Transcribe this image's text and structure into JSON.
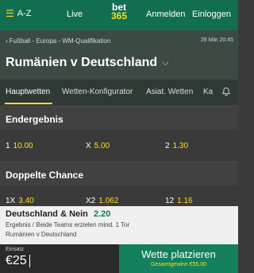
{
  "topbar": {
    "az_label": "A-Z",
    "live_label": "Live",
    "logo_top": "bet",
    "logo_bottom": "365",
    "login_label": "Anmelden",
    "signin_label": "Einloggen"
  },
  "header": {
    "breadcrumb": "Fußball - Europa - WM-Qualifikation",
    "datetime": "28 Mär 20:45",
    "match_title": "Rumänien v Deutschland"
  },
  "tabs": [
    {
      "label": "Hauptwetten",
      "active": true
    },
    {
      "label": "Wetten-Konfigurator",
      "active": false
    },
    {
      "label": "Asiat. Wetten",
      "active": false
    },
    {
      "label": "Ka",
      "active": false
    }
  ],
  "sections": {
    "endergebnis": {
      "title": "Endergebnis",
      "odds": [
        {
          "label": "1",
          "value": "10.00"
        },
        {
          "label": "X",
          "value": "5.00"
        },
        {
          "label": "2",
          "value": "1.30"
        }
      ]
    },
    "doppelte_chance": {
      "title": "Doppelte Chance",
      "odds": [
        {
          "label": "1X",
          "value": "3.40"
        },
        {
          "label": "X2",
          "value": "1.062"
        },
        {
          "label": "12",
          "value": "1.16"
        }
      ]
    }
  },
  "betslip": {
    "selection": "Deutschland & Nein",
    "price": "2.20",
    "market": "Ergebnis / Beide Teams erzielen mind. 1 Tor",
    "event": "Rumänien v Deutschland"
  },
  "bottom": {
    "stake_label": "Einsatz",
    "stake_amount": "€25",
    "place_label": "Wette platzieren",
    "total_win": "Gesamtgewinn €55,00"
  },
  "colors": {
    "brand_green": "#126e51",
    "accent_yellow": "#ffdf1b",
    "place_green": "#14805e"
  },
  "icons": [
    "menu-icon",
    "chevron-left-icon",
    "chevron-down-icon",
    "bell-icon"
  ]
}
